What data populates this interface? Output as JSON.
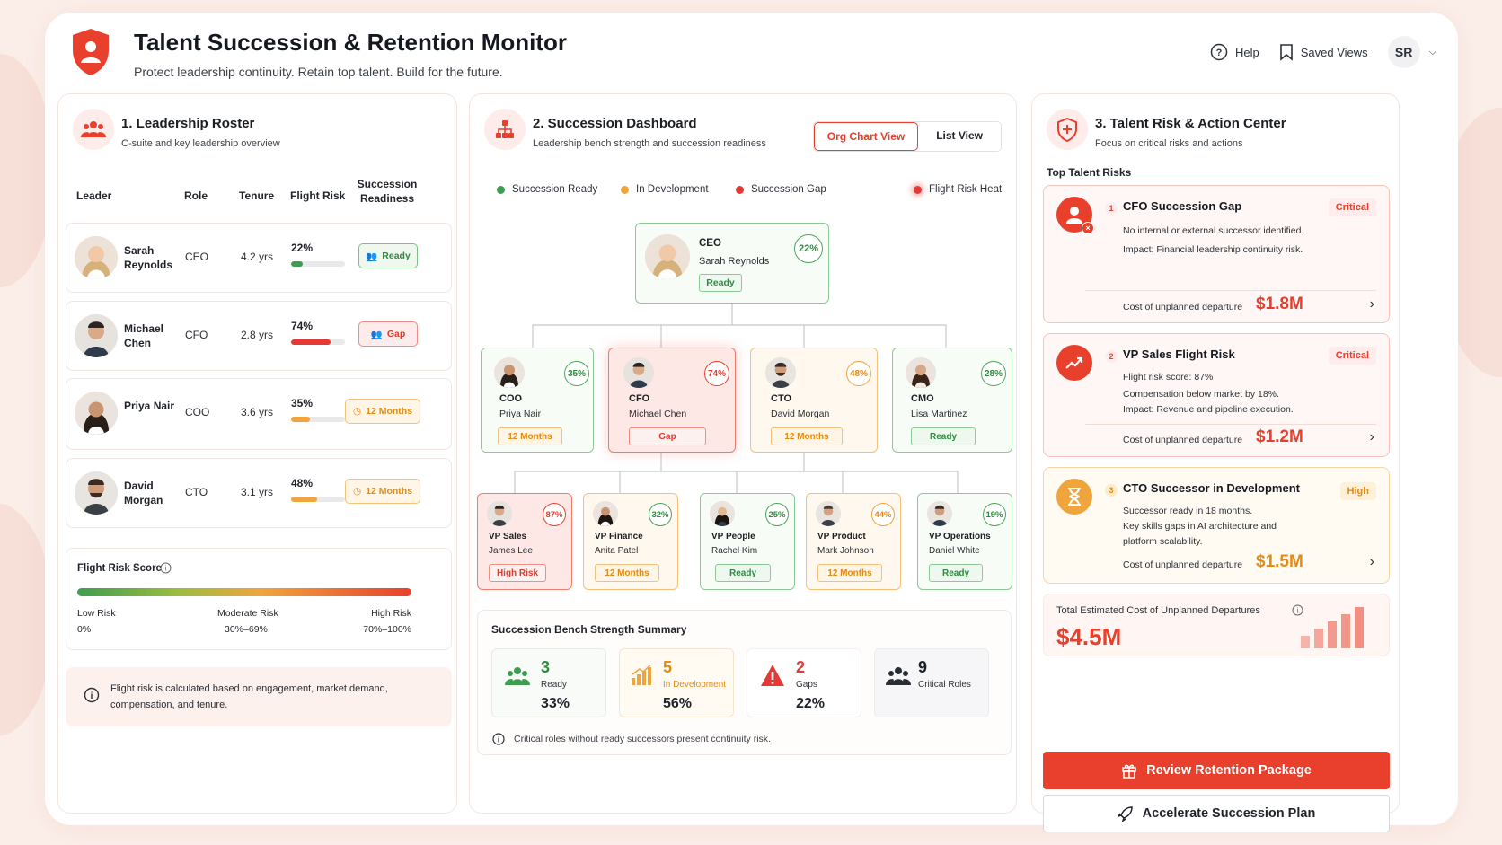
{
  "header": {
    "title": "Talent Succession & Retention Monitor",
    "subtitle": "Protect leadership continuity. Retain top talent. Build for the future.",
    "help": "Help",
    "saved_views": "Saved Views",
    "user_initials": "SR"
  },
  "roster": {
    "title": "1. Leadership Roster",
    "subtitle": "C-suite and key leadership overview",
    "columns": [
      "Leader",
      "Role",
      "Tenure",
      "Flight Risk",
      "Succession Readiness"
    ],
    "rows": [
      {
        "name": "Sarah Reynolds",
        "role": "CEO",
        "tenure": "4.2 yrs",
        "risk": "22%",
        "risk_value": 22,
        "status": "Ready",
        "type": "ready"
      },
      {
        "name": "Michael Chen",
        "role": "CFO",
        "tenure": "2.8 yrs",
        "risk": "74%",
        "risk_value": 74,
        "status": "Gap",
        "type": "gap"
      },
      {
        "name": "Priya Nair",
        "role": "COO",
        "tenure": "3.6 yrs",
        "risk": "35%",
        "risk_value": 35,
        "status": "12 Months",
        "type": "months"
      },
      {
        "name": "David Morgan",
        "role": "CTO",
        "tenure": "3.1 yrs",
        "risk": "48%",
        "risk_value": 48,
        "status": "12 Months",
        "type": "months"
      }
    ],
    "flight_score": {
      "title": "Flight Risk Score",
      "low": "Low Risk",
      "low_range": "0%",
      "mod": "Moderate Risk",
      "mod_range": "30%–69%",
      "high": "High Risk",
      "high_range": "70%–100%"
    },
    "note": "Flight risk is calculated based on engagement, market demand, compensation, and tenure."
  },
  "succession": {
    "title": "2. Succession Dashboard",
    "subtitle": "Leadership bench strength and succession readiness",
    "view_org": "Org Chart View",
    "view_list": "List View",
    "legend": {
      "ready": "Succession Ready",
      "dev": "In Development",
      "gap": "Succession Gap",
      "heat": "Flight Risk Heat"
    },
    "ceo": {
      "role": "CEO",
      "name": "Sarah Reynolds",
      "pct": "22%",
      "status": "Ready"
    },
    "level2": [
      {
        "role": "COO",
        "name": "Priya Nair",
        "pct": "35%",
        "status": "12 Months"
      },
      {
        "role": "CFO",
        "name": "Michael Chen",
        "pct": "74%",
        "status": "Gap"
      },
      {
        "role": "CTO",
        "name": "David Morgan",
        "pct": "48%",
        "status": "12 Months"
      },
      {
        "role": "CMO",
        "name": "Lisa Martinez",
        "pct": "28%",
        "status": "Ready"
      }
    ],
    "level3": [
      {
        "role": "VP Sales",
        "name": "James Lee",
        "pct": "87%",
        "status": "High Risk"
      },
      {
        "role": "VP Finance",
        "name": "Anita Patel",
        "pct": "32%",
        "status": "12 Months"
      },
      {
        "role": "VP People",
        "name": "Rachel Kim",
        "pct": "25%",
        "status": "Ready"
      },
      {
        "role": "VP Product",
        "name": "Mark Johnson",
        "pct": "44%",
        "status": "12 Months"
      },
      {
        "role": "VP Operations",
        "name": "Daniel White",
        "pct": "19%",
        "status": "Ready"
      }
    ],
    "bench": {
      "title": "Succession Bench Strength Summary",
      "tiles": [
        {
          "count": "3",
          "label": "Ready",
          "pct": "33%"
        },
        {
          "count": "5",
          "label": "In Development",
          "pct": "56%"
        },
        {
          "count": "2",
          "label": "Gaps",
          "pct": "22%"
        },
        {
          "count": "9",
          "label": "Critical Roles",
          "pct": ""
        }
      ],
      "note": "Critical roles without ready successors present continuity risk."
    }
  },
  "risk": {
    "title": "3. Talent Risk & Action Center",
    "subtitle": "Focus on critical risks and actions",
    "top": "Top Talent Risks",
    "cost_label": "Cost of unplanned departure",
    "items": [
      {
        "num": "1",
        "title": "CFO Succession Gap",
        "tag": "Critical",
        "lines": [
          "No internal or external successor identified.",
          "Impact: Financial leadership continuity risk."
        ],
        "cost": "$1.8M"
      },
      {
        "num": "2",
        "title": "VP Sales Flight Risk",
        "tag": "Critical",
        "lines": [
          "Flight risk score: 87%",
          "Compensation below market by 18%.",
          "Impact: Revenue and pipeline execution."
        ],
        "cost": "$1.2M"
      },
      {
        "num": "3",
        "title": "CTO Successor in Development",
        "tag": "High",
        "lines": [
          "Successor ready in 18 months.",
          "Key skills gaps in AI architecture and platform scalability."
        ],
        "cost": "$1.5M"
      }
    ],
    "total_label": "Total Estimated Cost of Unplanned Departures",
    "total": "$4.5M",
    "btn_primary": "Review Retention Package",
    "btn_secondary": "Accelerate Succession Plan"
  },
  "colors": {
    "accent": "#e8402c",
    "ready": "#3f9d4f",
    "dev": "#f0a43c",
    "gap": "#e53935"
  }
}
